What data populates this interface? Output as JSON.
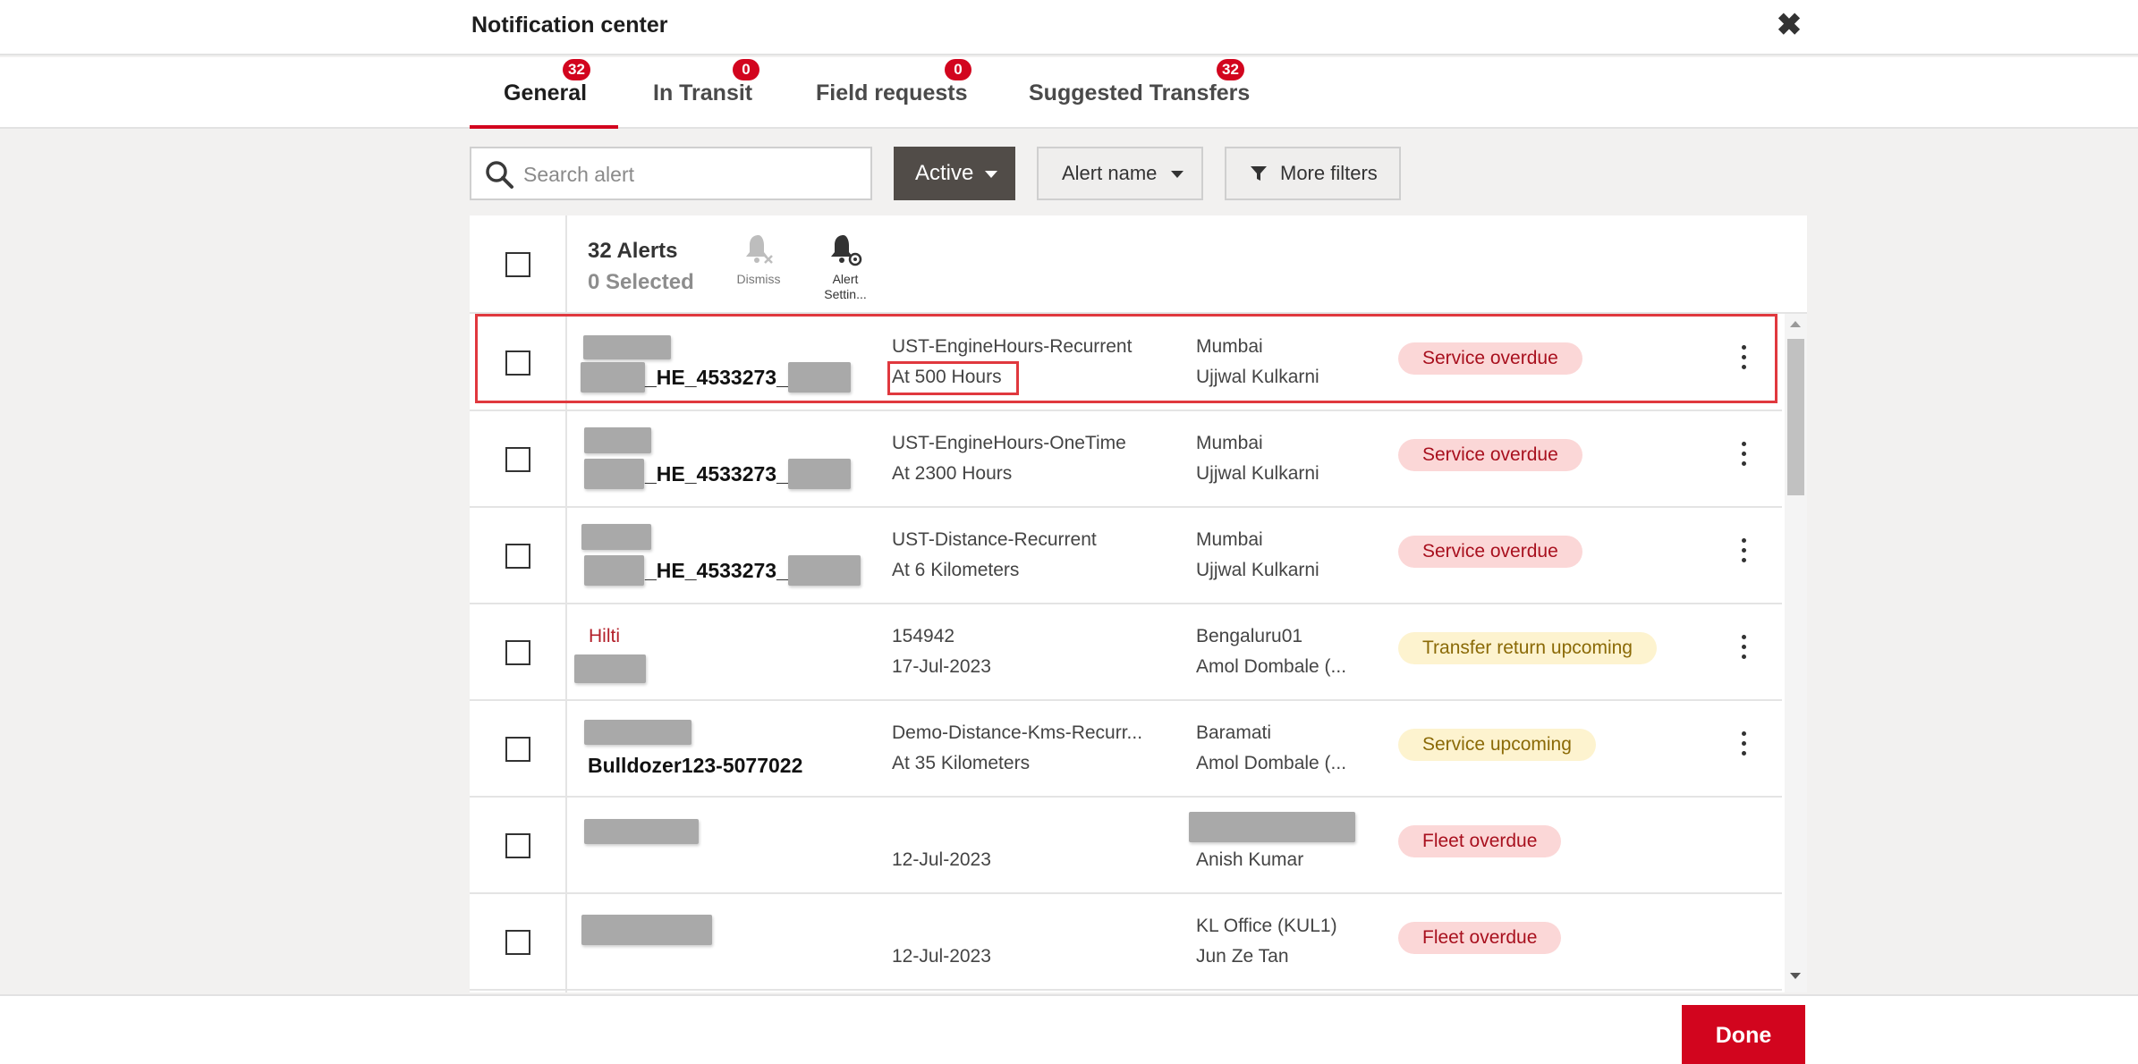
{
  "header": {
    "title": "Notification center",
    "close_label": "✖"
  },
  "tabs": [
    {
      "label": "General",
      "count": "32",
      "active": true
    },
    {
      "label": "In Transit",
      "count": "0"
    },
    {
      "label": "Field requests",
      "count": "0"
    },
    {
      "label": "Suggested Transfers",
      "count": "32"
    }
  ],
  "filters": {
    "search_placeholder": "Search alert",
    "status_label": "Active",
    "alert_name_label": "Alert name",
    "more_filters_label": "More filters"
  },
  "table_header": {
    "alert_count": "32 Alerts",
    "selected_count": "0 Selected",
    "dismiss_label": "Dismiss",
    "alert_settings_label": "Alert Settin..."
  },
  "rows": [
    {
      "asset_top": "",
      "asset": "_HE_4533273_",
      "alert": "UST-EngineHours-Recurrent",
      "detail": "At 500 Hours",
      "location": "Mumbai",
      "person": "Ujjwal Kulkarni",
      "status": "Service overdue",
      "status_type": "red"
    },
    {
      "asset_top": "",
      "asset": "_HE_4533273_",
      "alert": "UST-EngineHours-OneTime",
      "detail": "At 2300 Hours",
      "location": "Mumbai",
      "person": "Ujjwal Kulkarni",
      "status": "Service overdue",
      "status_type": "red"
    },
    {
      "asset_top": "",
      "asset": "_HE_4533273_",
      "alert": "UST-Distance-Recurrent",
      "detail": "At 6 Kilometers",
      "location": "Mumbai",
      "person": "Ujjwal Kulkarni",
      "status": "Service overdue",
      "status_type": "red"
    },
    {
      "asset_top": "Hilti",
      "asset": "",
      "alert": "154942",
      "detail": "17-Jul-2023",
      "location": "Bengaluru01",
      "person": "Amol Dombale (...",
      "status": "Transfer return upcoming",
      "status_type": "yellow"
    },
    {
      "asset_top": "",
      "asset": "Bulldozer123-5077022",
      "alert": "Demo-Distance-Kms-Recurr...",
      "detail": "At 35 Kilometers",
      "location": "Baramati",
      "person": "Amol Dombale (...",
      "status": "Service upcoming",
      "status_type": "yellow"
    },
    {
      "asset_top": "",
      "asset": "",
      "alert": "",
      "detail": "12-Jul-2023",
      "location": "",
      "person": "Anish Kumar",
      "status": "Fleet overdue",
      "status_type": "red"
    },
    {
      "asset_top": "",
      "asset": "",
      "alert": "",
      "detail": "12-Jul-2023",
      "location": "KL Office (KUL1)",
      "person": "Jun Ze Tan",
      "status": "Fleet overdue",
      "status_type": "red"
    }
  ],
  "footer": {
    "done_label": "Done"
  },
  "colors": {
    "accent": "#d2051e",
    "status_red_bg": "#fbd7d7",
    "status_yellow_bg": "#fdf3cf"
  }
}
